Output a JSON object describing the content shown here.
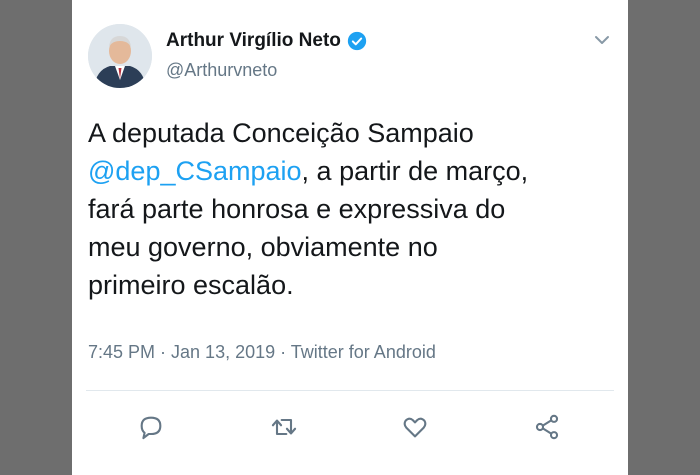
{
  "tweet": {
    "author_name": "Arthur Virgílio Neto",
    "handle": "@Arthurvneto",
    "verified": true,
    "lines": [
      {
        "parts": [
          {
            "text": "A deputada Conceição Sampaio",
            "mention": false
          }
        ]
      },
      {
        "parts": [
          {
            "text": "@dep_CSampaio",
            "mention": true
          },
          {
            "text": ", a partir de março,",
            "mention": false
          }
        ]
      },
      {
        "parts": [
          {
            "text": "fará parte honrosa e expressiva do",
            "mention": false
          }
        ]
      },
      {
        "parts": [
          {
            "text": "meu governo, obviamente no",
            "mention": false
          }
        ]
      },
      {
        "parts": [
          {
            "text": "primeiro escalão.",
            "mention": false
          }
        ]
      }
    ],
    "meta": "7:45 PM · Jan 13, 2019 · Twitter for Android"
  },
  "actions": [
    {
      "name": "reply-icon"
    },
    {
      "name": "retweet-icon"
    },
    {
      "name": "like-icon"
    },
    {
      "name": "share-icon"
    }
  ],
  "colors": {
    "accent": "#1da1f2",
    "text": "#14171a",
    "muted": "#657786",
    "background_frame": "#6e6e6e"
  }
}
